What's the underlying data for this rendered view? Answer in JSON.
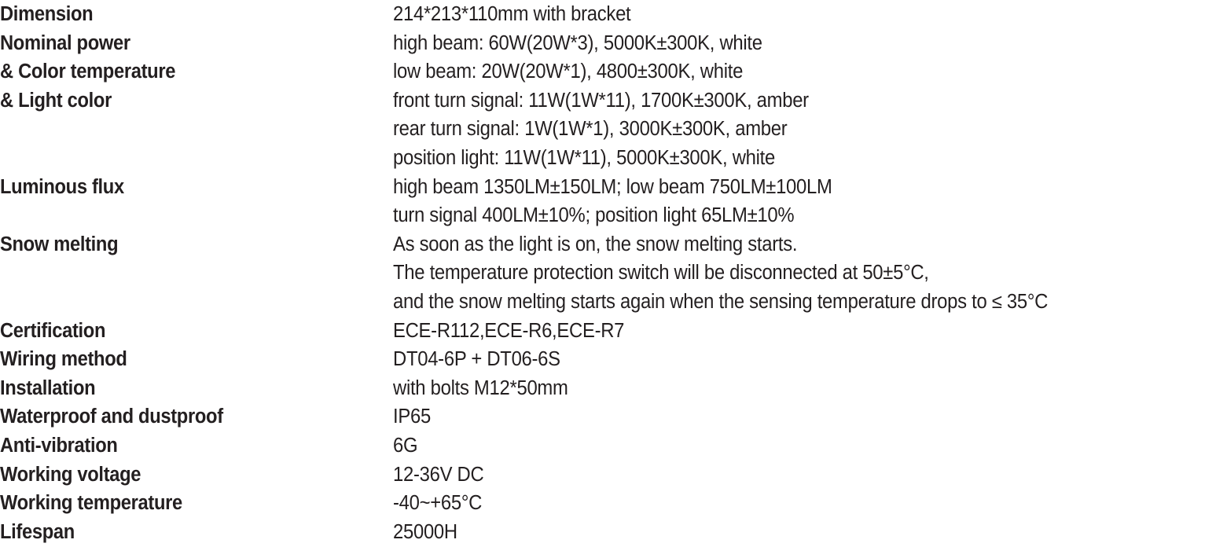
{
  "document": {
    "type": "product-specification-table",
    "title": "",
    "background_color": "#ffffff",
    "text_color": "#231f20"
  },
  "columns": {
    "label_header": "",
    "value_header": ""
  },
  "rows": [
    {
      "label": "Dimension",
      "value": "214*213*110mm with bracket"
    },
    {
      "label": "Nominal power",
      "value": "high beam: 60W(20W*3), 5000K±300K, white"
    },
    {
      "label": "& Color temperature",
      "value": "low beam: 20W(20W*1), 4800±300K, white"
    },
    {
      "label": "& Light color",
      "value": "front turn signal: 11W(1W*11), 1700K±300K, amber"
    },
    {
      "label": "",
      "value": "rear turn signal: 1W(1W*1), 3000K±300K, amber"
    },
    {
      "label": "",
      "value": "position light: 11W(1W*11), 5000K±300K, white"
    },
    {
      "label": "Luminous flux",
      "value": "high beam 1350LM±150LM; low beam 750LM±100LM"
    },
    {
      "label": "",
      "value": "turn signal 400LM±10%; position light 65LM±10%"
    },
    {
      "label": "Snow melting",
      "value": "As soon as the light is on, the snow melting starts."
    },
    {
      "label": "",
      "value": "The temperature protection switch will be disconnected at 50±5°C,"
    },
    {
      "label": "",
      "value": "and the snow melting starts again when the sensing temperature drops to ≤ 35°C"
    },
    {
      "label": "Certification",
      "value": "ECE-R112,ECE-R6,ECE-R7"
    },
    {
      "label": "Wiring method",
      "value": "DT04-6P + DT06-6S"
    },
    {
      "label": "Installation",
      "value": "with bolts M12*50mm"
    },
    {
      "label": "Waterproof and dustproof",
      "value": "IP65"
    },
    {
      "label": "Anti-vibration",
      "value": "6G"
    },
    {
      "label": "Working voltage",
      "value": "12-36V DC"
    },
    {
      "label": "Working temperature",
      "value": "-40~+65°C"
    },
    {
      "label": "Lifespan",
      "value": "25000H"
    }
  ]
}
